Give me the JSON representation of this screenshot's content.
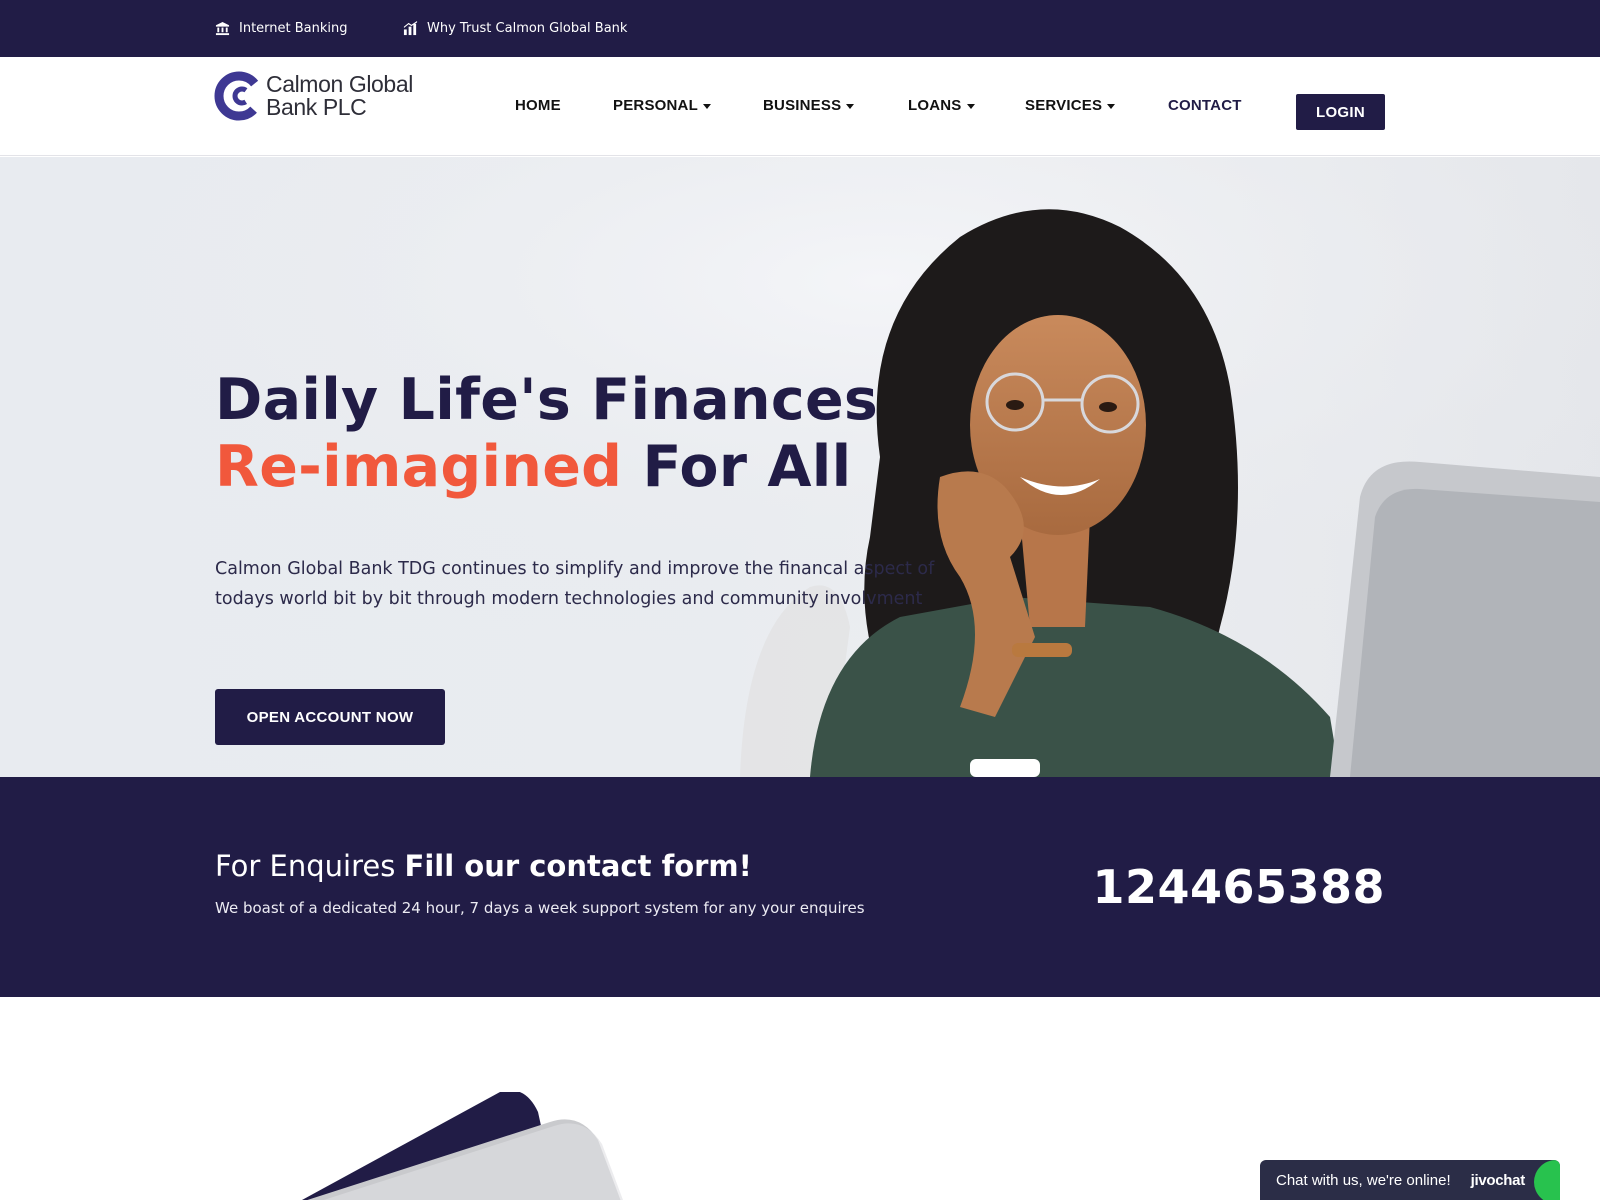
{
  "topbar": {
    "internet_banking": "Internet Banking",
    "why_trust": "Why Trust Calmon Global Bank"
  },
  "header": {
    "logo_line1": "Calmon Global",
    "logo_line2": "Bank PLC",
    "nav": {
      "home": "HOME",
      "personal": "PERSONAL",
      "business": "BUSINESS",
      "loans": "LOANS",
      "services": "SERVICES",
      "contact": "CONTACT"
    },
    "login_label": "LOGIN"
  },
  "hero": {
    "title_line1": "Daily Life's Finances",
    "title_accent": "Re-imagined",
    "title_rest": "For All",
    "description": "Calmon Global Bank TDG continues to simplify and improve the financal aspect of todays world bit by bit through modern technologies and community involvment",
    "cta_label": "OPEN ACCOUNT NOW"
  },
  "enquiries": {
    "lead": "For Enquires",
    "emphasis": "Fill our contact form!",
    "subtitle": "We boast of a dedicated 24 hour, 7 days a week support system for any your enquires",
    "phone": "124465388"
  },
  "chat": {
    "message": "Chat with us, we're online!",
    "brand": "jivochat"
  },
  "colors": {
    "navy": "#211c46",
    "accent": "#f1583c",
    "chat_green": "#28c24e"
  }
}
